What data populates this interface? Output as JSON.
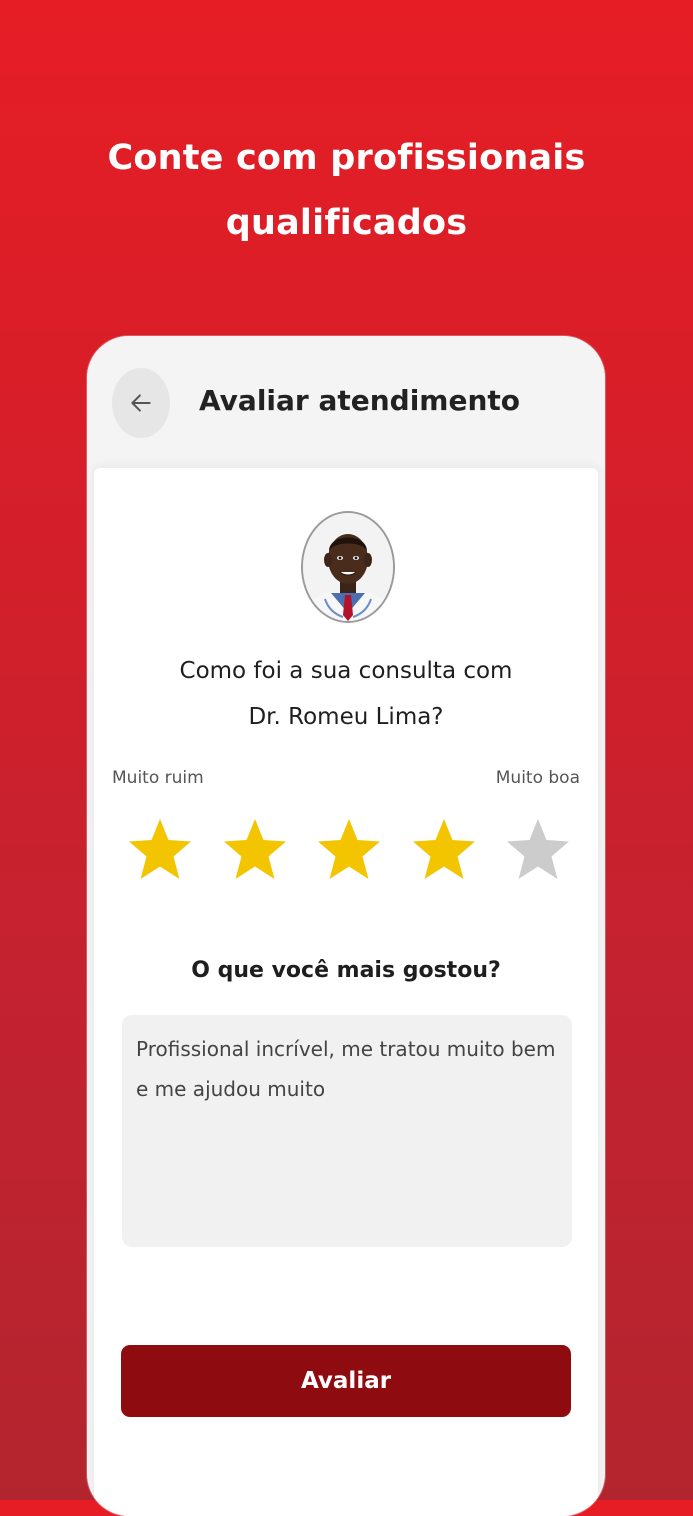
{
  "colors": {
    "background_top": "#e61d25",
    "background_bottom": "#b3252e",
    "button": "#8e0b10",
    "star_active": "#f2c500",
    "star_inactive": "#cccccc"
  },
  "headline": {
    "line1": "Conte com profissionais",
    "line2": "qualificados"
  },
  "header": {
    "title": "Avaliar atendimento",
    "back_icon": "arrow-left-icon"
  },
  "rating": {
    "question_line1": "Como foi a sua consulta com",
    "question_line2": "Dr. Romeu Lima?",
    "label_low": "Muito ruim",
    "label_high": "Muito boa",
    "max": 5,
    "value": 4
  },
  "feedback": {
    "title": "O que você mais gostou?",
    "value": "Profissional incrível, me tratou muito bem e me ajudou muito"
  },
  "submit": {
    "label": "Avaliar"
  }
}
